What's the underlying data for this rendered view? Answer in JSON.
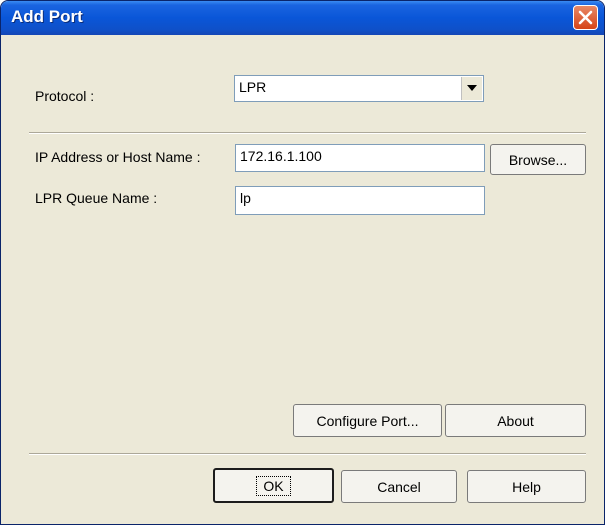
{
  "window": {
    "title": "Add Port"
  },
  "protocol": {
    "label": "Protocol :",
    "value": "LPR"
  },
  "ip": {
    "label": "IP Address or Host Name :",
    "value": "172.16.1.100",
    "browse_label": "Browse..."
  },
  "queue": {
    "label": "LPR Queue Name :",
    "value": "lp"
  },
  "buttons": {
    "configure": "Configure Port...",
    "about": "About",
    "ok": "OK",
    "cancel": "Cancel",
    "help": "Help"
  },
  "icons": {
    "close": "close-icon",
    "dropdown": "chevron-down-icon"
  }
}
